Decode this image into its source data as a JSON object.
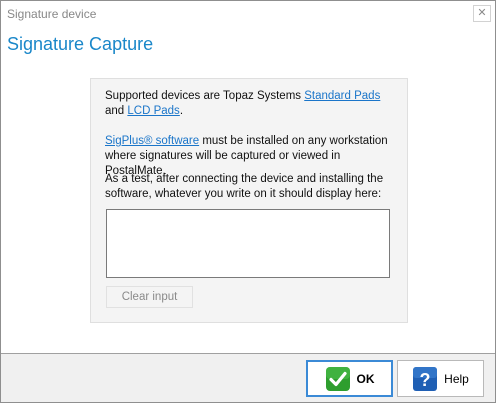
{
  "window": {
    "title": "Signature device",
    "close_symbol": "✕"
  },
  "header": {
    "page_title": "Signature Capture"
  },
  "info": {
    "p1_text_before": "Supported devices are Topaz Systems ",
    "p1_link1": "Standard Pads",
    "p1_text_middle": "and ",
    "p1_link2": "LCD Pads",
    "p1_text_end": ".",
    "p2_link": "SigPlus® software",
    "p2_text": " must be installed on any workstation where signatures will be captured or viewed in PostalMate.",
    "p3_text": "As a test, after connecting the device and installing the software, whatever you write on it should display here:"
  },
  "signature": {
    "clear_label": "Clear input"
  },
  "footer": {
    "ok_label": "OK",
    "help_label": "Help"
  },
  "icons": {
    "ok": "checkmark-icon",
    "help": "question-icon"
  },
  "colors": {
    "title_blue": "#1a87c9",
    "link_blue": "#1a75c9",
    "ok_green": "#2e9e2e",
    "help_blue": "#1f5fb4",
    "focus_border": "#3b8ad6"
  }
}
